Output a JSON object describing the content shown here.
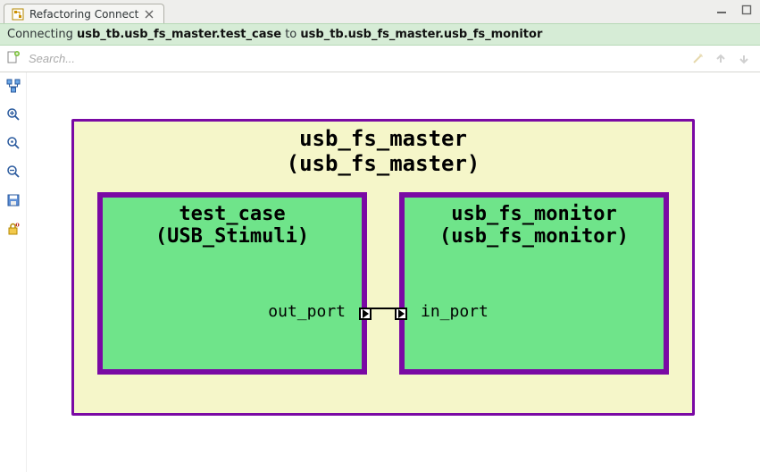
{
  "tab": {
    "title": "Refactoring Connect",
    "icon": "flowchart-icon"
  },
  "status": {
    "prefix": "Connecting ",
    "from": "usb_tb.usb_fs_master.test_case",
    "mid": " to ",
    "to": "usb_tb.usb_fs_master.usb_fs_monitor"
  },
  "search": {
    "placeholder": "Search..."
  },
  "diagram": {
    "outer": {
      "name": "usb_fs_master",
      "type": "usb_fs_master"
    },
    "left": {
      "name": "test_case",
      "type": "USB_Stimuli",
      "out_port": "out_port"
    },
    "right": {
      "name": "usb_fs_monitor",
      "type": "usb_fs_monitor",
      "in_port": "in_port"
    }
  },
  "toolbar_icons": {
    "new": "new-icon",
    "layout": "layout-icon",
    "zoom_in": "zoom-in-icon",
    "zoom_reset": "zoom-reset-icon",
    "zoom_out": "zoom-out-icon",
    "save": "save-icon",
    "lock": "lock-icon",
    "wand": "wand-icon",
    "up": "arrow-up-icon",
    "down": "arrow-down-icon"
  }
}
